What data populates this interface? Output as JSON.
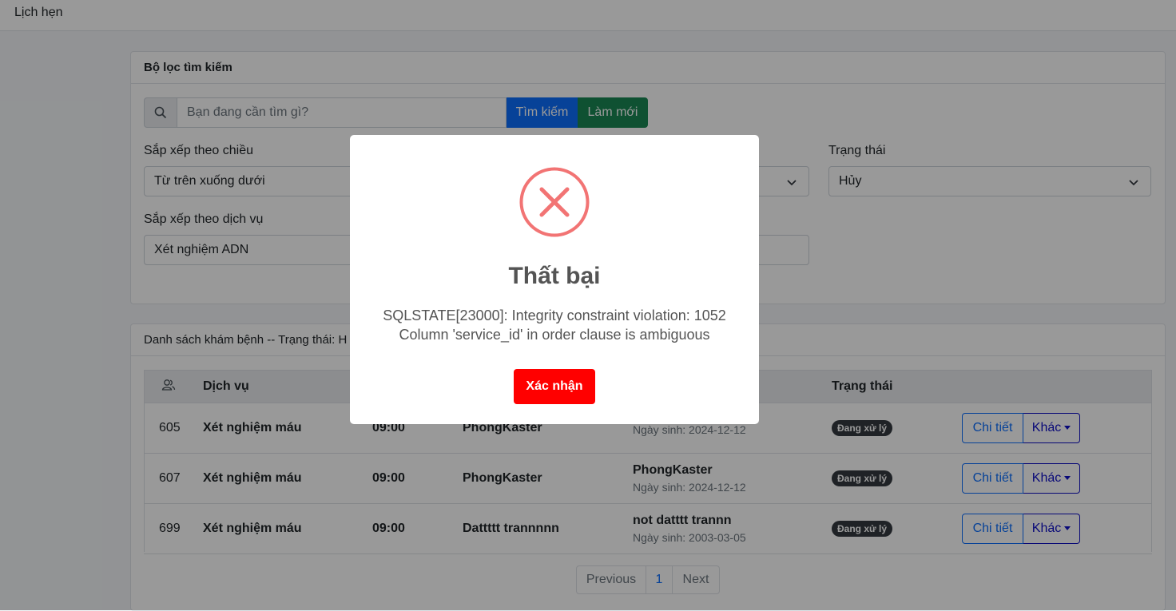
{
  "topbar": {
    "breadcrumb": "Lịch hẹn"
  },
  "filter": {
    "title": "Bộ lọc tìm kiếm",
    "search_placeholder": "Bạn đang cần tìm gì?",
    "search_button": "Tìm kiếm",
    "reset_button": "Làm mới",
    "sort_direction_label": "Sắp xếp theo chiều",
    "sort_direction_value": "Từ trên xuống dưới",
    "status_label": "Trạng thái",
    "status_value": "Hủy",
    "sort_service_label": "Sắp xếp theo dịch vụ",
    "sort_service_value": "Xét nghiệm ADN"
  },
  "list": {
    "header": "Danh sách khám bệnh -- Trạng thái: H",
    "columns": {
      "service": "Dịch vụ",
      "status": "Trạng thái"
    },
    "rows": [
      {
        "id": "605",
        "service": "Xét nghiệm máu",
        "time": "09:00",
        "doctor": "PhongKaster",
        "patient": "",
        "dob": "Ngày sinh: 2024-12-12",
        "status": "Đang xử lý",
        "detail": "Chi tiết",
        "more": "Khác"
      },
      {
        "id": "607",
        "service": "Xét nghiệm máu",
        "time": "09:00",
        "doctor": "PhongKaster",
        "patient": "PhongKaster",
        "dob": "Ngày sinh: 2024-12-12",
        "status": "Đang xử lý",
        "detail": "Chi tiết",
        "more": "Khác"
      },
      {
        "id": "699",
        "service": "Xét nghiệm máu",
        "time": "09:00",
        "doctor": "Dattttt trannnnn",
        "patient": "not datttt trannn",
        "dob": "Ngày sinh: 2003-03-05",
        "status": "Đang xử lý",
        "detail": "Chi tiết",
        "more": "Khác"
      }
    ]
  },
  "pagination": {
    "previous": "Previous",
    "page": "1",
    "next": "Next"
  },
  "modal": {
    "icon": "error-x-icon",
    "title": "Thất bại",
    "message_line1": "SQLSTATE[23000]: Integrity constraint violation: 1052",
    "message_line2": "Column 'service_id' in order clause is ambiguous",
    "confirm": "Xác nhận"
  },
  "colors": {
    "primary": "#0d6efd",
    "success": "#198754",
    "error": "#f27474",
    "confirm": "#ff0000",
    "badge": "#343a40"
  }
}
